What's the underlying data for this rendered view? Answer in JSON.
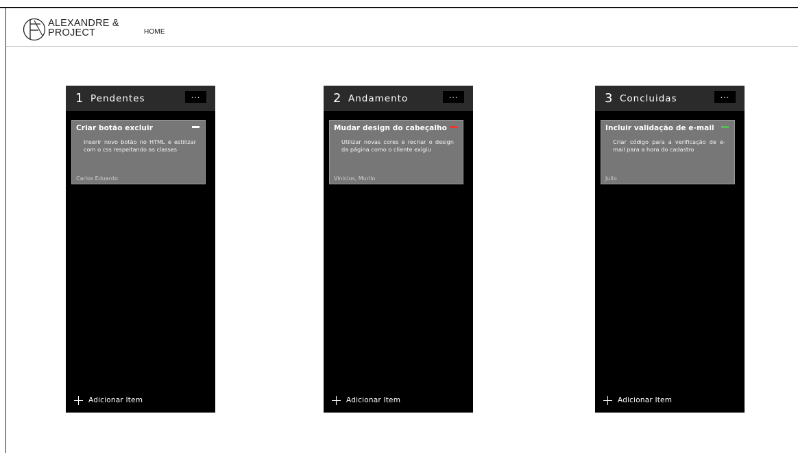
{
  "header": {
    "brand_line1": "ALEXANDRE &",
    "brand_line2": "PROJECT",
    "nav_home": "HOME"
  },
  "columns": [
    {
      "number": "1",
      "title": "Pendentes",
      "menu": "...",
      "card": {
        "title": "Criar botão excluir",
        "flag_color": "#ffffff",
        "description": "Inserir novo botão no HTML e estilizar com o css respeitando as classes",
        "author": "Carlos Eduardo"
      },
      "add_label": "Adicionar Item"
    },
    {
      "number": "2",
      "title": "Andamento",
      "menu": "...",
      "card": {
        "title": "Mudar design do cabeçalho",
        "flag_color": "#e53935",
        "description": "Utilizar novas cores e recriar o design da página como o cliente exigiu",
        "author": "Vinicius, Murilo"
      },
      "add_label": "Adicionar Item"
    },
    {
      "number": "3",
      "title": "Concluidas",
      "menu": "...",
      "card": {
        "title": "Incluir validação de e-mail",
        "flag_color": "#5cb85c",
        "description": "Criar código para a verificação de e-mail para a hora do cadastro",
        "author": "Julio"
      },
      "add_label": "Adicionar Item"
    }
  ]
}
